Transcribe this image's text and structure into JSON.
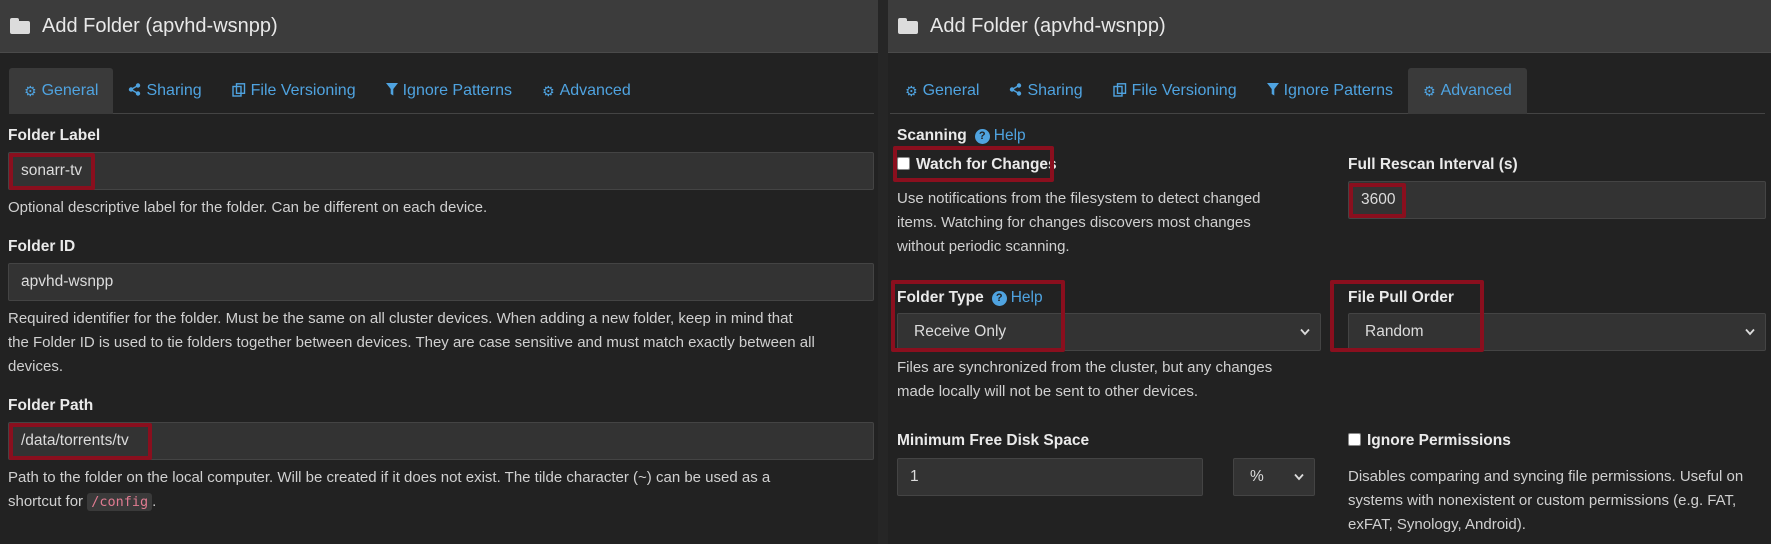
{
  "left": {
    "title": "Add Folder (apvhd-wsnpp)",
    "tabs": [
      {
        "label": "General",
        "icon": "gear-icon",
        "active": true
      },
      {
        "label": "Sharing",
        "icon": "share-icon",
        "active": false
      },
      {
        "label": "File Versioning",
        "icon": "copy-icon",
        "active": false
      },
      {
        "label": "Ignore Patterns",
        "icon": "filter-icon",
        "active": false
      },
      {
        "label": "Advanced",
        "icon": "gears-icon",
        "active": false
      }
    ],
    "folder_label": {
      "label": "Folder Label",
      "value": "sonarr-tv",
      "help": "Optional descriptive label for the folder. Can be different on each device."
    },
    "folder_id": {
      "label": "Folder ID",
      "value": "apvhd-wsnpp",
      "help_line1": "Required identifier for the folder. Must be the same on all cluster devices. When adding a new folder, keep in mind that",
      "help_line2": "the Folder ID is used to tie folders together between devices. They are case sensitive and must match exactly between all",
      "help_line3": "devices."
    },
    "folder_path": {
      "label": "Folder Path",
      "value": "/data/torrents/tv",
      "help_line1": "Path to the folder on the local computer. Will be created if it does not exist. The tilde character (~) can be used as a",
      "help_line2_prefix": "shortcut for",
      "help_code": "/config",
      "help_line2_suffix": "."
    }
  },
  "right": {
    "title": "Add Folder (apvhd-wsnpp)",
    "tabs": [
      {
        "label": "General",
        "icon": "gear-icon",
        "active": false
      },
      {
        "label": "Sharing",
        "icon": "share-icon",
        "active": false
      },
      {
        "label": "File Versioning",
        "icon": "copy-icon",
        "active": false
      },
      {
        "label": "Ignore Patterns",
        "icon": "filter-icon",
        "active": false
      },
      {
        "label": "Advanced",
        "icon": "gears-icon",
        "active": true
      }
    ],
    "scanning": {
      "label": "Scanning",
      "help_link": "Help"
    },
    "watch": {
      "label": "Watch for Changes",
      "checked": false,
      "help_line1": "Use notifications from the filesystem to detect changed",
      "help_line2": "items. Watching for changes discovers most changes",
      "help_line3": "without periodic scanning."
    },
    "rescan": {
      "label": "Full Rescan Interval (s)",
      "value": "3600"
    },
    "folder_type": {
      "label": "Folder Type",
      "help_link": "Help",
      "value": "Receive Only",
      "help_line1": "Files are synchronized from the cluster, but any changes",
      "help_line2": "made locally will not be sent to other devices."
    },
    "pull_order": {
      "label": "File Pull Order",
      "value": "Random"
    },
    "min_disk": {
      "label": "Minimum Free Disk Space",
      "value": "1",
      "unit": "%"
    },
    "ignore_perms": {
      "label": "Ignore Permissions",
      "checked": false,
      "help_line1": "Disables comparing and syncing file permissions. Useful on",
      "help_line2": "systems with nonexistent or custom permissions (e.g. FAT,",
      "help_line3": "exFAT, Synology, Android)."
    }
  },
  "colors": {
    "accent": "#4fa3e0",
    "highlight": "#8a0f1e",
    "background": "#222222",
    "header": "#3c3c3c"
  }
}
